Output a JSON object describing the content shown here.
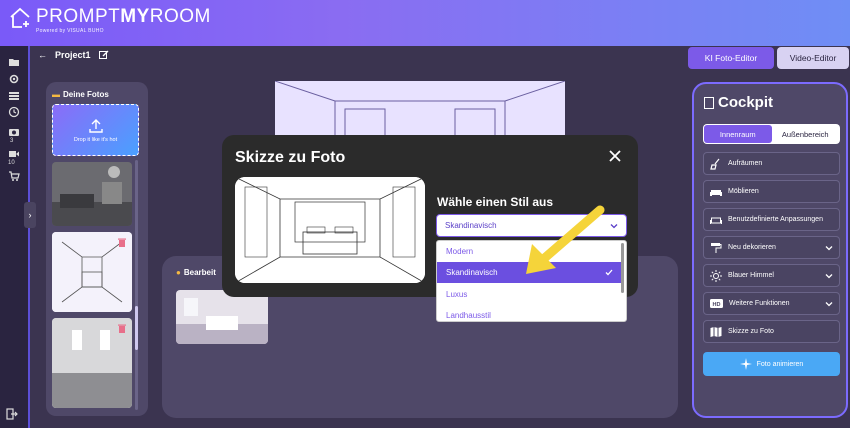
{
  "brand": {
    "name_prefix": "PROMPT",
    "name_bold": "MY",
    "name_suffix": "ROOM",
    "powered": "Powered by VISUAL BUHO"
  },
  "leftbar": {
    "icons": [
      "folder-icon",
      "gear-icon",
      "layers-icon",
      "history-icon",
      "camera-icon",
      "video-icon",
      "cart-icon",
      "logout-icon"
    ],
    "camera_count": "3",
    "video_count": "10"
  },
  "project": {
    "back_label": "←",
    "name": "Project1"
  },
  "top_tabs": {
    "ki": "KI Foto-Editor",
    "video": "Video-Editor"
  },
  "photos": {
    "title": "Deine Fotos",
    "upload_text": "Drop it like it's hot"
  },
  "editing": {
    "title": "Bearbeit"
  },
  "cockpit": {
    "title": "Cockpit",
    "tabs": [
      {
        "label": "Innenraum",
        "active": true
      },
      {
        "label": "Außenbereich",
        "active": false
      }
    ],
    "items": [
      {
        "label": "Aufräumen",
        "icon": "broom-icon",
        "has_chevron": false
      },
      {
        "label": "Möblieren",
        "icon": "sofa-icon",
        "has_chevron": false
      },
      {
        "label": "Benutzdefinierte Anpassungen",
        "icon": "sofa-outline-icon",
        "has_chevron": false
      },
      {
        "label": "Neu dekorieren",
        "icon": "paint-roller-icon",
        "has_chevron": true
      },
      {
        "label": "Blauer Himmel",
        "icon": "sun-icon",
        "has_chevron": true
      },
      {
        "label": "Weitere Funktionen",
        "icon": "hd-icon",
        "has_chevron": true
      },
      {
        "label": "Skizze zu Foto",
        "icon": "map-icon",
        "has_chevron": false
      }
    ],
    "animate_label": "Foto animieren"
  },
  "modal": {
    "title": "Skizze zu Foto",
    "style_label": "Wähle einen Stil aus",
    "selected": "Skandinavisch",
    "options": [
      "Modern",
      "Skandinavisch",
      "Luxus",
      "Landhausstil"
    ],
    "selected_index": 1
  },
  "colors": {
    "accent": "#7c5ae8",
    "header_start": "#7a5af8",
    "header_end": "#6f8ef5",
    "arrow": "#f5d43a",
    "animate": "#4aa8f5"
  }
}
